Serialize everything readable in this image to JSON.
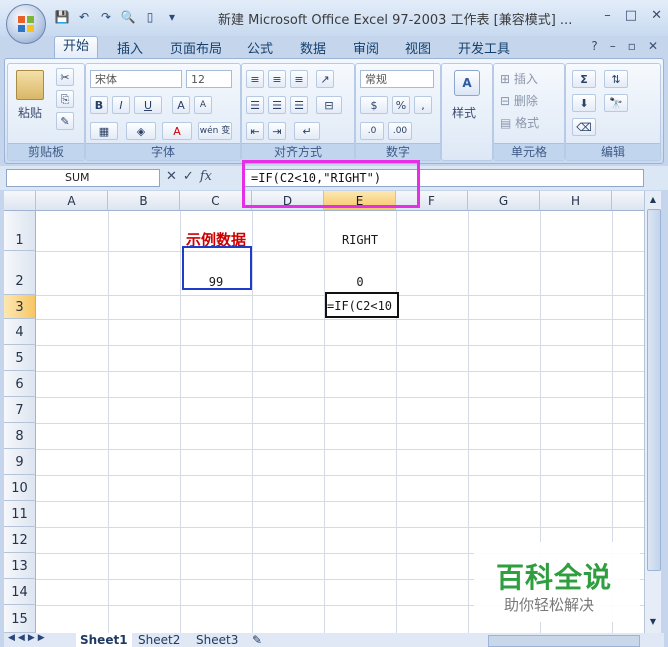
{
  "window": {
    "title": "新建 Microsoft Office Excel 97-2003 工作表 [兼容模式] ...",
    "controls": [
      "–",
      "□",
      "✕"
    ]
  },
  "ribbon_tabs": [
    "开始",
    "插入",
    "页面布局",
    "公式",
    "数据",
    "审阅",
    "视图",
    "开发工具"
  ],
  "ribbon": {
    "clipboard": {
      "label": "剪贴板",
      "paste": "粘贴"
    },
    "font": {
      "label": "字体",
      "name": "宋体",
      "size": "12",
      "bold": "B",
      "italic": "I",
      "underline": "U",
      "grow": "A",
      "shrink": "A",
      "wen": "wén 变"
    },
    "alignment": {
      "label": "对齐方式"
    },
    "number": {
      "label": "数字",
      "format": "常规",
      "percent": "%",
      "comma": ","
    },
    "styles": {
      "label": "样式"
    },
    "cells": {
      "label": "单元格",
      "insert": "插入",
      "delete": "删除",
      "format": "格式"
    },
    "editing": {
      "label": "编辑"
    }
  },
  "formula_bar": {
    "name_box": "SUM",
    "fx": "fx",
    "formula": "=IF(C2<10,\"RIGHT\")"
  },
  "columns": [
    "A",
    "B",
    "C",
    "D",
    "E",
    "F",
    "G",
    "H"
  ],
  "rows": [
    "1",
    "2",
    "3",
    "4",
    "5",
    "6",
    "7",
    "8",
    "9",
    "10",
    "11",
    "12",
    "13",
    "14",
    "15"
  ],
  "cells": {
    "C1": "示例数据",
    "E1": "RIGHT",
    "C2": "99",
    "E2": "0",
    "E3": "=IF(C2<10"
  },
  "sheets": [
    "Sheet1",
    "Sheet2",
    "Sheet3"
  ],
  "watermark": {
    "title": "百科全说",
    "subtitle": "助你轻松解决"
  },
  "colors": {
    "accent_highlight": "#e62ee6",
    "red_text": "#cc0000",
    "watermark_green": "#2e9e3e"
  }
}
